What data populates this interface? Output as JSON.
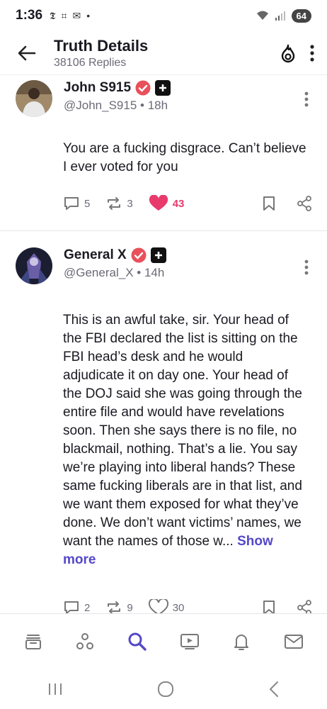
{
  "status_bar": {
    "time": "1:36",
    "battery": "64"
  },
  "header": {
    "title": "Truth Details",
    "subtitle": "38106 Replies"
  },
  "posts": [
    {
      "name": "John S915",
      "handle": "@John_S915",
      "age": "18h",
      "text": "You are a fucking disgrace. Can’t believe I ever voted for you",
      "replies": "5",
      "retruths": "3",
      "likes": "43",
      "liked": true
    },
    {
      "name": "General X",
      "handle": "@General_X",
      "age": "14h",
      "text": "This is an awful take, sir. Your head of the FBI declared the list is sitting on the FBI head’s desk and he would adjudicate it on day one. Your head of the DOJ said she was going through the entire file and would have revelations soon. Then she says there is no file, no blackmail, nothing. That’s a lie. You say we’re playing into liberal hands? These same fucking liberals are in that list, and we want them exposed for what they’ve done. We don’t want victims’ names, we want the names of those w...",
      "show_more": "Show more",
      "replies": "2",
      "retruths": "9",
      "likes": "30",
      "liked": false
    }
  ],
  "colors": {
    "accent": "#5448c8",
    "like": "#e83a6c",
    "verified": "#e8505b"
  },
  "bottom_nav": [
    "feed-icon",
    "groups-icon",
    "search-icon",
    "video-icon",
    "notifications-icon",
    "messages-icon"
  ]
}
